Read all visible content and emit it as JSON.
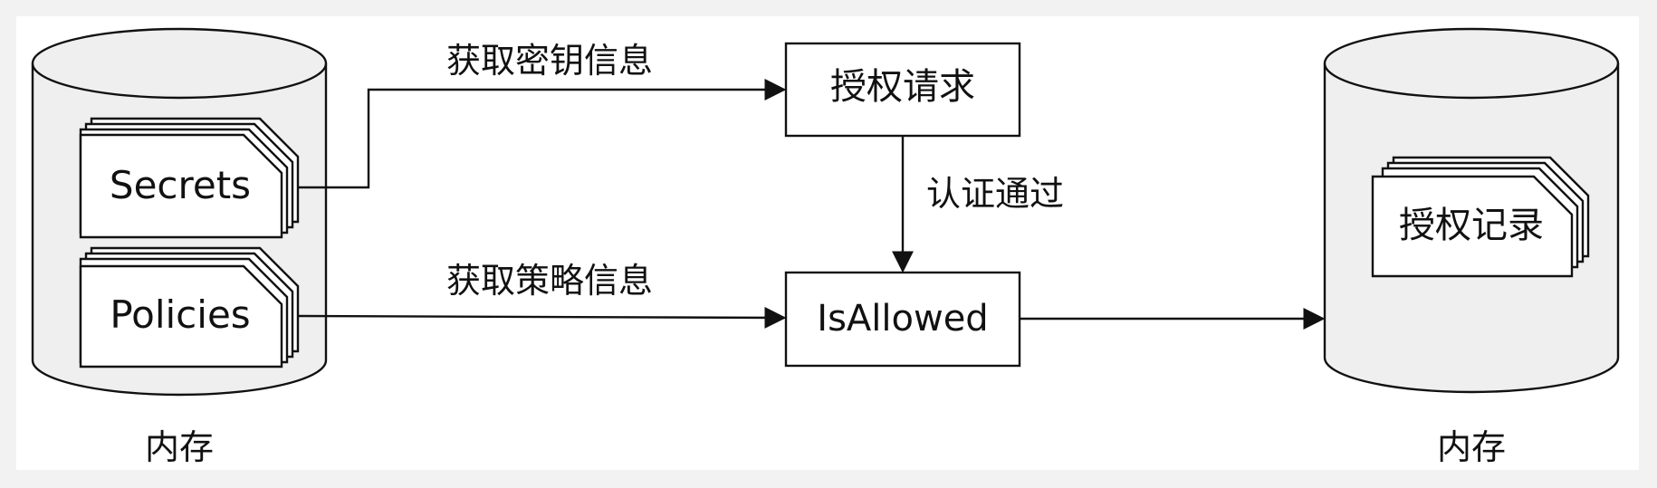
{
  "left_store": {
    "label": "内存",
    "docs": [
      "Secrets",
      "Policies"
    ]
  },
  "right_store": {
    "label": "内存",
    "docs": [
      "授权记录"
    ]
  },
  "boxes": {
    "auth_request": "授权请求",
    "is_allowed": "IsAllowed"
  },
  "edges": {
    "get_secrets": "获取密钥信息",
    "auth_passed": "认证通过",
    "get_policies": "获取策略信息"
  }
}
